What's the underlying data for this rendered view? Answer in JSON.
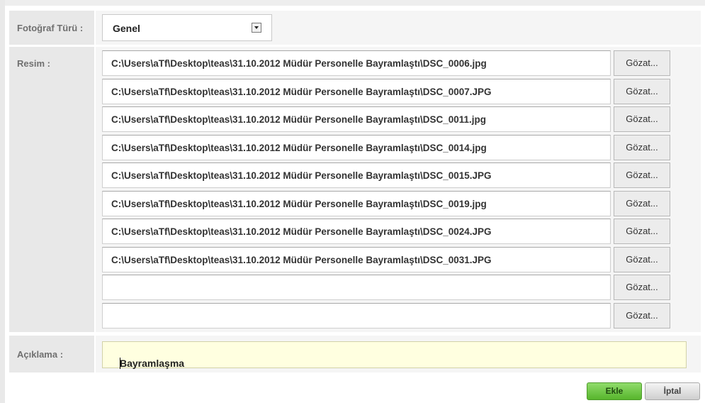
{
  "form": {
    "photo_type": {
      "label": "Fotoğraf Türü :",
      "value": "Genel"
    },
    "image": {
      "label": "Resim :",
      "browse_label": "Gözat...",
      "files": [
        "C:\\Users\\aTf\\Desktop\\teas\\31.10.2012 Müdür Personelle Bayramlaştı\\DSC_0006.jpg",
        "C:\\Users\\aTf\\Desktop\\teas\\31.10.2012 Müdür Personelle Bayramlaştı\\DSC_0007.JPG",
        "C:\\Users\\aTf\\Desktop\\teas\\31.10.2012 Müdür Personelle Bayramlaştı\\DSC_0011.jpg",
        "C:\\Users\\aTf\\Desktop\\teas\\31.10.2012 Müdür Personelle Bayramlaştı\\DSC_0014.jpg",
        "C:\\Users\\aTf\\Desktop\\teas\\31.10.2012 Müdür Personelle Bayramlaştı\\DSC_0015.JPG",
        "C:\\Users\\aTf\\Desktop\\teas\\31.10.2012 Müdür Personelle Bayramlaştı\\DSC_0019.jpg",
        "C:\\Users\\aTf\\Desktop\\teas\\31.10.2012 Müdür Personelle Bayramlaştı\\DSC_0024.JPG",
        "C:\\Users\\aTf\\Desktop\\teas\\31.10.2012 Müdür Personelle Bayramlaştı\\DSC_0031.JPG",
        "",
        ""
      ]
    },
    "description": {
      "label": "Açıklama :",
      "value": "Bayramlaşma"
    }
  },
  "actions": {
    "add_label": "Ekle",
    "cancel_label": "İptal"
  },
  "colors": {
    "add_button": "#5cb82f",
    "description_bg": "#ffffe0"
  }
}
